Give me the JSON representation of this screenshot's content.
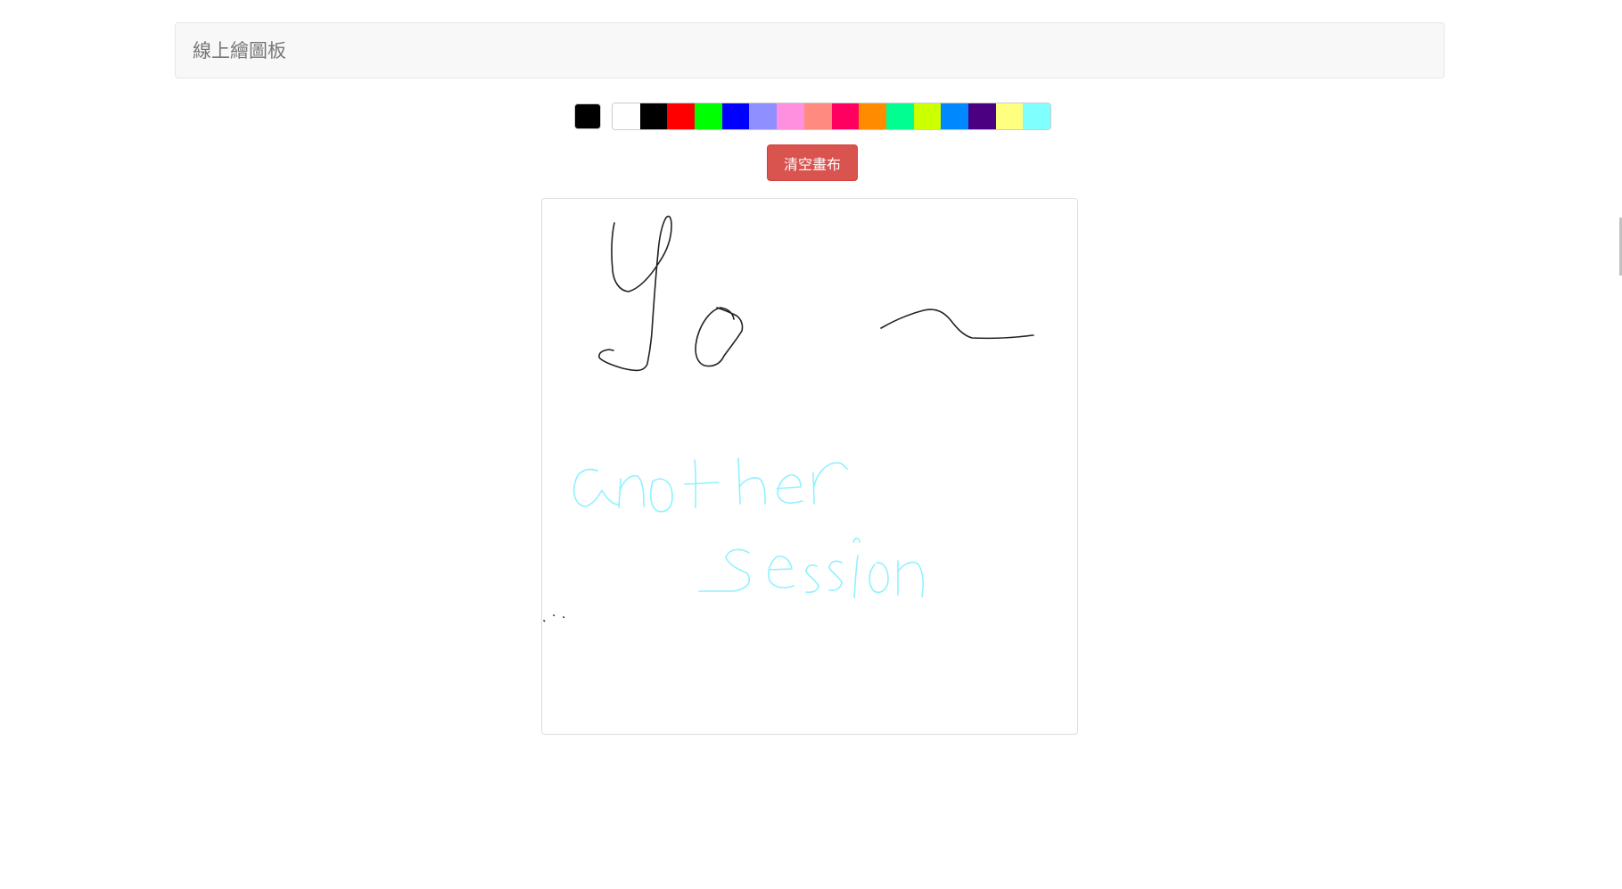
{
  "navbar": {
    "brand": "線上繪圖板"
  },
  "toolbar": {
    "current_color": "#000000",
    "palette": [
      {
        "name": "white",
        "color": "#ffffff"
      },
      {
        "name": "black",
        "color": "#000000"
      },
      {
        "name": "red",
        "color": "#ff0000"
      },
      {
        "name": "green",
        "color": "#00ff00"
      },
      {
        "name": "blue",
        "color": "#0000ff"
      },
      {
        "name": "periwinkle",
        "color": "#8f8fff"
      },
      {
        "name": "pink",
        "color": "#ff8fdf"
      },
      {
        "name": "salmon",
        "color": "#ff8a80"
      },
      {
        "name": "crimson",
        "color": "#ff0060"
      },
      {
        "name": "orange",
        "color": "#ff8c00"
      },
      {
        "name": "spring-green",
        "color": "#00ff90"
      },
      {
        "name": "lime",
        "color": "#ccff00"
      },
      {
        "name": "azure",
        "color": "#0088ff"
      },
      {
        "name": "indigo",
        "color": "#4b0082"
      },
      {
        "name": "light-yellow",
        "color": "#ffff80"
      },
      {
        "name": "light-cyan",
        "color": "#80ffff"
      }
    ],
    "clear_label": "清空畫布"
  },
  "canvas": {
    "stroke_colors": {
      "ink": "#222222",
      "cyan": "#8ff2ff"
    }
  }
}
